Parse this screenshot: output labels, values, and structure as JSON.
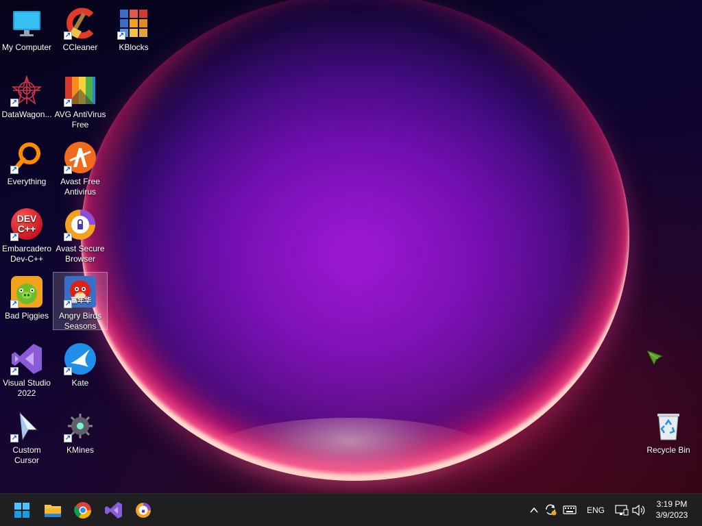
{
  "desktop": {
    "icons": [
      {
        "label": "My Computer"
      },
      {
        "label": "CCleaner"
      },
      {
        "label": "KBlocks"
      },
      {
        "label": "DataWagon..."
      },
      {
        "label": "AVG AntiVirus Free"
      },
      {
        "label": "Everything"
      },
      {
        "label": "Avast Free Antivirus"
      },
      {
        "label": "Embarcadero Dev-C++"
      },
      {
        "label": "Avast Secure Browser"
      },
      {
        "label": "Bad Piggies"
      },
      {
        "label": "Angry Birds Seasons"
      },
      {
        "label": "Visual Studio 2022"
      },
      {
        "label": "Kate"
      },
      {
        "label": "Custom Cursor"
      },
      {
        "label": "KMines"
      },
      {
        "label": "Recycle Bin"
      }
    ],
    "devcpp_icon_text": "DEV C++",
    "angry_birds_icon_text": "嘉年华"
  },
  "taskbar": {
    "apps": [
      "start-icon",
      "file-explorer-icon",
      "chrome-icon",
      "visual-studio-icon",
      "avast-secure-browser-icon"
    ],
    "tray": {
      "language": "ENG",
      "time": "3:19 PM",
      "date": "3/9/2023"
    }
  },
  "colors": {
    "taskbar_bg": "#1f1f22",
    "accent_blue": "#0a84ff"
  }
}
